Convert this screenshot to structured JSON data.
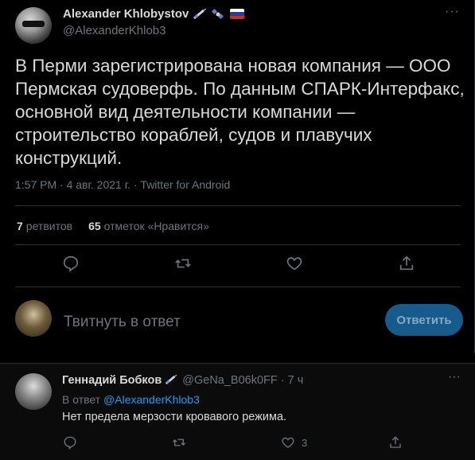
{
  "tweet": {
    "author_name": "Alexander Khlobystov",
    "author_handle": "@AlexanderKhlob3",
    "text": "В Перми зарегистрирована новая компания — ООО Пермская судоверфь. По данным СПАРК-Интерфакс, основной вид деятельности компании — строительство кораблей, судов и плавучих конструкций.",
    "meta": "1:57 PM · 4 авг. 2021 г. · Twitter for Android",
    "retweets_count": "7",
    "retweets_label": "ретвитов",
    "likes_count": "65",
    "likes_label": "отметок «Нравится»",
    "more": "···"
  },
  "reply_box": {
    "placeholder": "Твитнуть в ответ",
    "button": "Ответить"
  },
  "reply": {
    "name": "Геннадий Бобков",
    "handle": "@GeNa_B06k0FF",
    "time": "· 7 ч",
    "reply_to_prefix": "В ответ",
    "reply_to_handle": "@AlexanderKhlob3",
    "text": "Нет предела мерзости кровавого режима.",
    "likes_count": "3",
    "more": "···"
  },
  "colors": {
    "background": "#000000",
    "accent": "#1d9bf0",
    "muted": "#6e767d",
    "button": "#175a8c"
  },
  "icons": [
    "syringe-icon",
    "satellite-icon",
    "russia-flag-icon",
    "comment-icon",
    "retweet-icon",
    "heart-icon",
    "share-icon",
    "more-icon"
  ]
}
